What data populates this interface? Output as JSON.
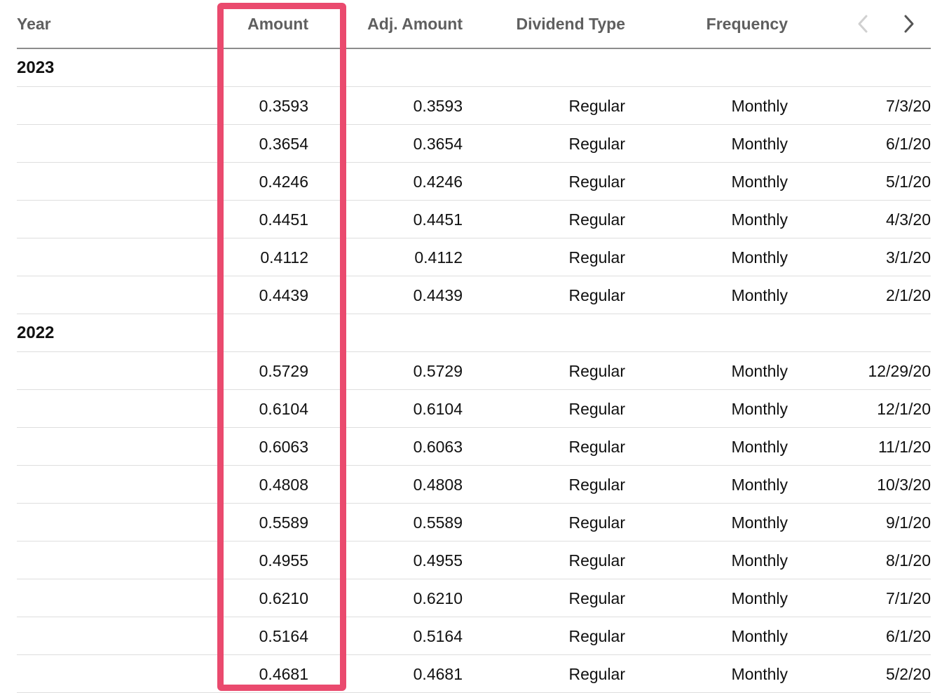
{
  "table": {
    "headers": {
      "year": "Year",
      "amount": "Amount",
      "adj_amount": "Adj. Amount",
      "dividend_type": "Dividend Type",
      "frequency": "Frequency"
    },
    "nav": {
      "prev_icon": "chevron-left-icon",
      "next_icon": "chevron-right-icon"
    },
    "groups": [
      {
        "year": "2023",
        "rows": [
          {
            "amount": "0.3593",
            "adj_amount": "0.3593",
            "type": "Regular",
            "frequency": "Monthly",
            "date": "7/3/20"
          },
          {
            "amount": "0.3654",
            "adj_amount": "0.3654",
            "type": "Regular",
            "frequency": "Monthly",
            "date": "6/1/20"
          },
          {
            "amount": "0.4246",
            "adj_amount": "0.4246",
            "type": "Regular",
            "frequency": "Monthly",
            "date": "5/1/20"
          },
          {
            "amount": "0.4451",
            "adj_amount": "0.4451",
            "type": "Regular",
            "frequency": "Monthly",
            "date": "4/3/20"
          },
          {
            "amount": "0.4112",
            "adj_amount": "0.4112",
            "type": "Regular",
            "frequency": "Monthly",
            "date": "3/1/20"
          },
          {
            "amount": "0.4439",
            "adj_amount": "0.4439",
            "type": "Regular",
            "frequency": "Monthly",
            "date": "2/1/20"
          }
        ]
      },
      {
        "year": "2022",
        "rows": [
          {
            "amount": "0.5729",
            "adj_amount": "0.5729",
            "type": "Regular",
            "frequency": "Monthly",
            "date": "12/29/20"
          },
          {
            "amount": "0.6104",
            "adj_amount": "0.6104",
            "type": "Regular",
            "frequency": "Monthly",
            "date": "12/1/20"
          },
          {
            "amount": "0.6063",
            "adj_amount": "0.6063",
            "type": "Regular",
            "frequency": "Monthly",
            "date": "11/1/20"
          },
          {
            "amount": "0.4808",
            "adj_amount": "0.4808",
            "type": "Regular",
            "frequency": "Monthly",
            "date": "10/3/20"
          },
          {
            "amount": "0.5589",
            "adj_amount": "0.5589",
            "type": "Regular",
            "frequency": "Monthly",
            "date": "9/1/20"
          },
          {
            "amount": "0.4955",
            "adj_amount": "0.4955",
            "type": "Regular",
            "frequency": "Monthly",
            "date": "8/1/20"
          },
          {
            "amount": "0.6210",
            "adj_amount": "0.6210",
            "type": "Regular",
            "frequency": "Monthly",
            "date": "7/1/20"
          },
          {
            "amount": "0.5164",
            "adj_amount": "0.5164",
            "type": "Regular",
            "frequency": "Monthly",
            "date": "6/1/20"
          },
          {
            "amount": "0.4681",
            "adj_amount": "0.4681",
            "type": "Regular",
            "frequency": "Monthly",
            "date": "5/2/20"
          }
        ]
      }
    ]
  },
  "colors": {
    "highlight": "#ea4a6e",
    "header_text": "#5f5f5f",
    "divider": "#dedede"
  }
}
